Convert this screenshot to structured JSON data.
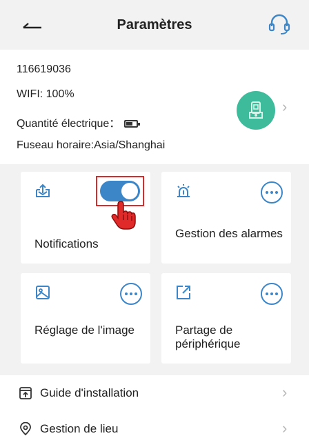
{
  "header": {
    "title": "Paramètres",
    "back_icon": "back-arrow-icon",
    "support_icon": "headset-icon"
  },
  "device": {
    "id": "116619036",
    "wifi": "WIFI:  100%",
    "battery_label": "Quantité électrique：",
    "timezone": "Fuseau horaire:Asia/Shanghai",
    "avatar_icon": "camera-icon",
    "avatar_color": "#3dbb9a"
  },
  "cards": [
    {
      "label": "Notifications",
      "icon": "inbox-upload-icon",
      "toggle_on": true
    },
    {
      "label": "Gestion des alarmes",
      "icon": "alarm-icon"
    },
    {
      "label": "Réglage de l'image",
      "icon": "image-icon"
    },
    {
      "label": "Partage de périphérique",
      "icon": "share-icon"
    }
  ],
  "list": [
    {
      "label": "Guide d'installation",
      "icon": "install-guide-icon"
    },
    {
      "label": "Gestion de lieu",
      "icon": "location-pin-icon"
    }
  ],
  "colors": {
    "accent": "#3c86c8",
    "highlight": "#e02a2a",
    "background": "#f2f2f2"
  }
}
